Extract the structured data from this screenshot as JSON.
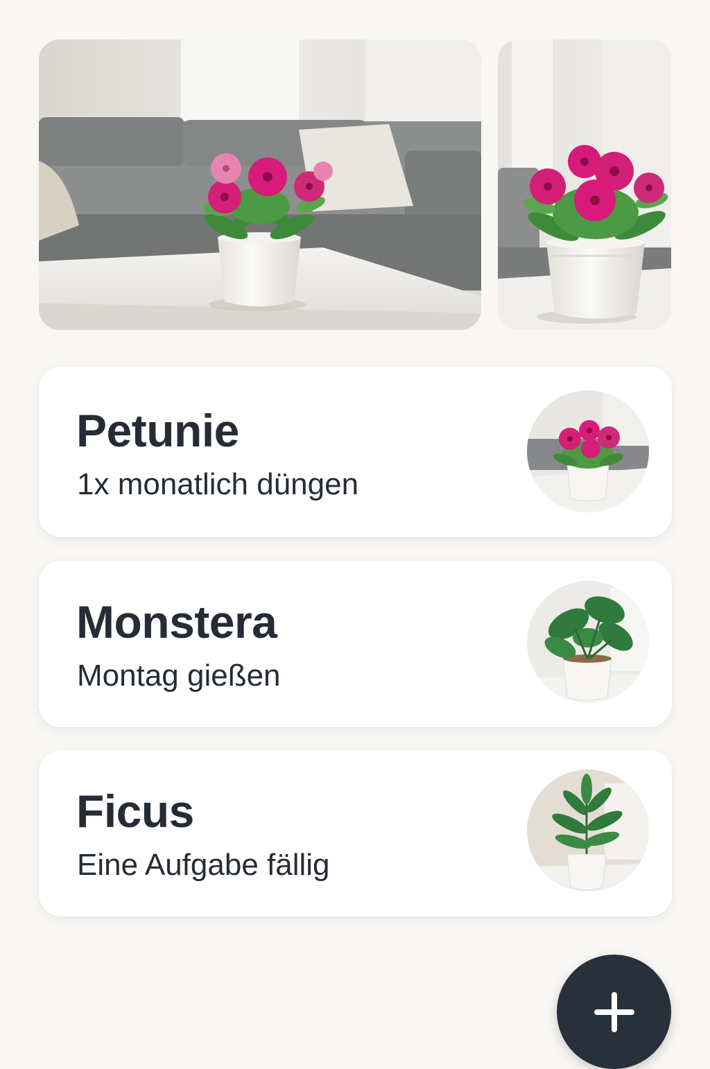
{
  "gallery": {
    "photos": [
      {
        "icon": "petunia-living-room-photo"
      },
      {
        "icon": "petunia-closeup-photo"
      }
    ]
  },
  "plants": [
    {
      "name": "Petunie",
      "task": "1x monatlich düngen",
      "icon": "petunia-thumbnail"
    },
    {
      "name": "Monstera",
      "task": "Montag gießen",
      "icon": "monstera-thumbnail"
    },
    {
      "name": "Ficus",
      "task": "Eine Aufgabe fällig",
      "icon": "ficus-thumbnail"
    }
  ],
  "actions": {
    "add_icon": "plus-icon"
  },
  "colors": {
    "background": "#f9f7f4",
    "card": "#ffffff",
    "text": "#252c35",
    "fab": "#28303b",
    "petunia_pink": "#d81b7a",
    "leaf_green": "#2f7a3c"
  }
}
